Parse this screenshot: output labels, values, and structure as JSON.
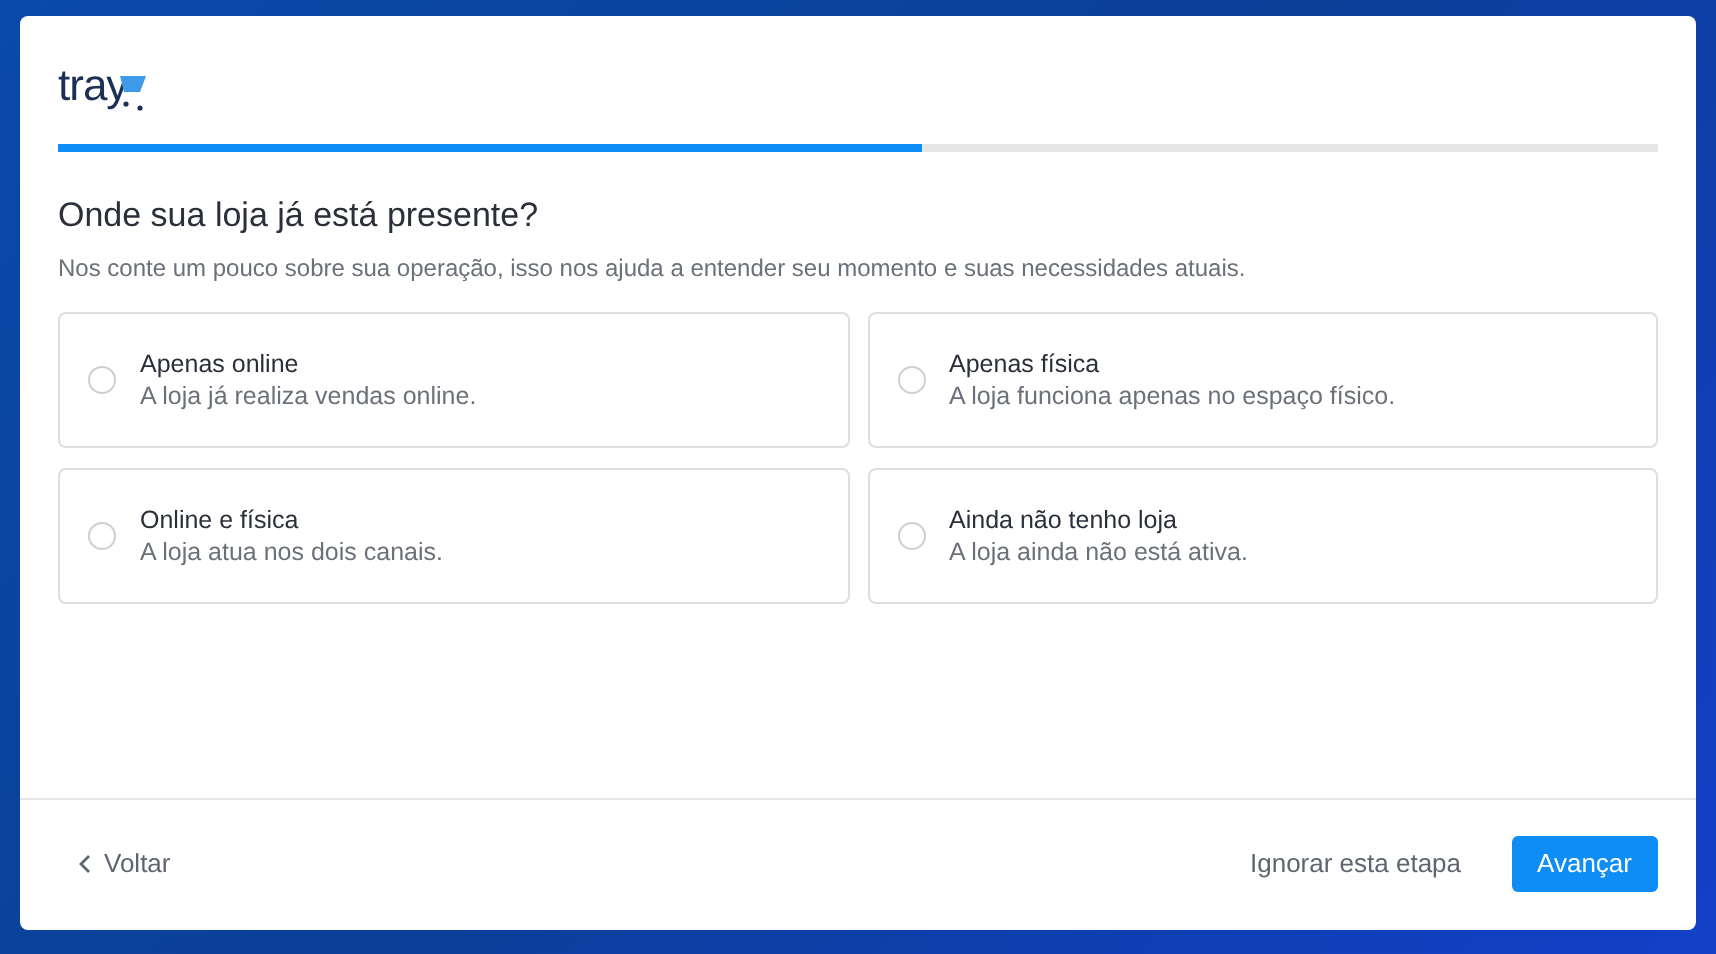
{
  "logo": {
    "text": "tray"
  },
  "progress": {
    "level": 0.54
  },
  "title": "Onde sua loja já está presente?",
  "subtitle": "Nos conte um pouco sobre sua operação, isso nos ajuda a entender seu momento e suas necessidades atuais.",
  "options": [
    {
      "label": "Apenas online",
      "description": "A loja já realiza vendas online.",
      "selected": false
    },
    {
      "label": "Apenas física",
      "description": "A loja funciona apenas no espaço físico.",
      "selected": false
    },
    {
      "label": "Online e física",
      "description": "A loja atua nos dois canais.",
      "selected": false
    },
    {
      "label": "Ainda não tenho loja",
      "description": "A loja ainda não está ativa.",
      "selected": false
    }
  ],
  "footer": {
    "back": "Voltar",
    "skip": "Ignorar esta etapa",
    "next": "Avançar"
  }
}
